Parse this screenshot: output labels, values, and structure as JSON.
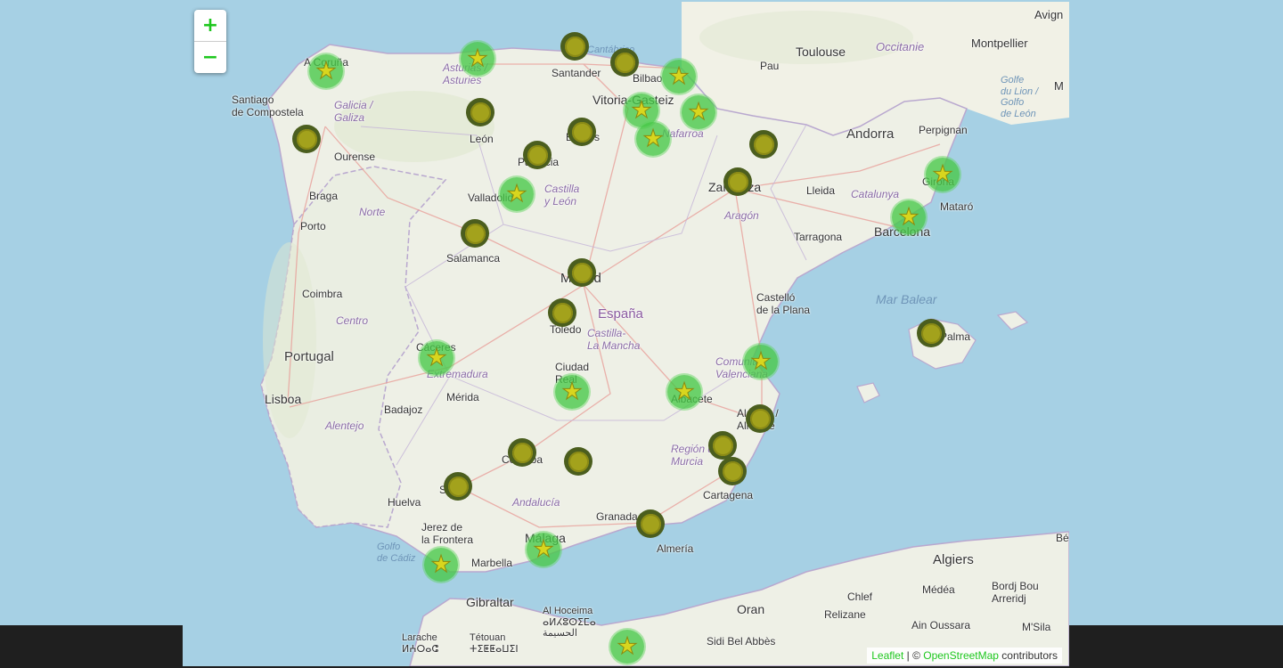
{
  "map": {
    "zoom_in_label": "+",
    "zoom_out_label": "−",
    "attribution": {
      "leaflet": "Leaflet",
      "separator": " | © ",
      "osm": "OpenStreetMap",
      "suffix": " contributors"
    }
  },
  "labels": {
    "toulouse": "Toulouse",
    "occitanie": "Occitanie",
    "montpellier": "Montpellier",
    "avignon": "Avign",
    "pau": "Pau",
    "andorra": "Andorra",
    "perpignan": "Perpignan",
    "golfe_lion": "Golfe\ndu Lion /\nGolfo\nde León",
    "m_edge": "M",
    "a_coruna": "A Coruña",
    "santiago": "Santiago\nde Compostela",
    "galicia": "Galicia /\nGaliza",
    "ourense": "Ourense",
    "asturias": "Asturias /\nAsturies",
    "leon": "León",
    "santander": "Santander",
    "cantabrico": "Cantábrico",
    "bilbao": "Bilbao",
    "vitoria": "Vitoria-Gasteiz",
    "navarra": "Nafarroa",
    "burgos": "Burgos",
    "palencia": "Palencia",
    "valladolid": "Valladolid",
    "castilla_leon": "Castilla\ny León",
    "zaragoza": "Zaragoza",
    "aragon": "Aragón",
    "lleida": "Lleida",
    "catalunya": "Catalunya",
    "girona": "Girona",
    "mataro": "Mataró",
    "barcelona": "Barcelona",
    "tarragona": "Tarragona",
    "braga": "Braga",
    "norte": "Norte",
    "porto": "Porto",
    "salamanca": "Salamanca",
    "madrid": "Madrid",
    "coimbra": "Coimbra",
    "centro": "Centro",
    "espana": "España",
    "toledo": "Toledo",
    "castellon": "Castelló\nde la Plana",
    "mar_balear": "Mar Balear",
    "palma": "Palma",
    "portugal": "Portugal",
    "caceres": "Cáceres",
    "castilla_mancha": "Castilla-\nLa Mancha",
    "ciudad_real": "Ciudad\nReal",
    "comunitat": "Comunitat\nValenciana",
    "extremadura": "Extremadura",
    "merida": "Mérida",
    "albacete": "Albacete",
    "lisboa": "Lisboa",
    "badajoz": "Badajoz",
    "alicante": "Alacant /\nAlicante",
    "alentejo": "Alentejo",
    "cordoba": "Córdoba",
    "jaen": "Jaén",
    "murcia": "Región de\nMurcia",
    "sevilla": "Sevilla",
    "andalucia": "Andalucía",
    "huelva": "Huelva",
    "granada": "Granada",
    "cartagena": "Cartagena",
    "jerez": "Jerez de\nla Frontera",
    "malaga": "Málaga",
    "almeria": "Almería",
    "golfo_cadiz": "Golfo\nde Cádiz",
    "marbella": "Marbella",
    "gibraltar": "Gibraltar",
    "algiers": "Algiers",
    "medea": "Médéa",
    "bordj": "Bordj Bou\nArreridj",
    "chlef": "Chlef",
    "relizane": "Relizane",
    "oran": "Oran",
    "alhoceima": "Al Hoceima\nⴰⵍⵃⵓⵙⵉⵎⴰ\nالحسيمة",
    "larache": "Larache\nⵍⵄⵔⴰⵛ",
    "tetouan": "Tétouan\nⵜⵉⵟⵟⴰⵡⵉⵏ",
    "sidi_bel_abbes": "Sidi Bel Abbès",
    "ain_oussara": "Ain Oussara",
    "msila": "M'Sila",
    "be_edge": "Bé"
  },
  "markers": [
    {
      "place": "A Coruña",
      "icon": "star-icon"
    },
    {
      "place": "Asturias",
      "icon": "star-icon"
    },
    {
      "place": "Santander",
      "icon": "dot-icon"
    },
    {
      "place": "Bilbao",
      "icon": "dot-icon"
    },
    {
      "place": "Donostia",
      "icon": "star-icon"
    },
    {
      "place": "Vitoria-Gasteiz",
      "icon": "star-icon"
    },
    {
      "place": "Navarra",
      "icon": "star-icon"
    },
    {
      "place": "La Rioja",
      "icon": "star-icon"
    },
    {
      "place": "Pontevedra",
      "icon": "dot-icon"
    },
    {
      "place": "León",
      "icon": "dot-icon"
    },
    {
      "place": "Burgos",
      "icon": "dot-icon"
    },
    {
      "place": "Palencia",
      "icon": "dot-icon"
    },
    {
      "place": "Huesca",
      "icon": "dot-icon"
    },
    {
      "place": "Valladolid",
      "icon": "star-icon"
    },
    {
      "place": "Zaragoza",
      "icon": "dot-icon"
    },
    {
      "place": "Girona",
      "icon": "star-icon"
    },
    {
      "place": "Barcelona",
      "icon": "star-icon"
    },
    {
      "place": "Zamora",
      "icon": "dot-icon"
    },
    {
      "place": "Madrid",
      "icon": "dot-icon"
    },
    {
      "place": "Toledo",
      "icon": "dot-icon"
    },
    {
      "place": "Palma",
      "icon": "dot-icon"
    },
    {
      "place": "Cáceres",
      "icon": "star-icon"
    },
    {
      "place": "Castellón",
      "icon": "star-icon"
    },
    {
      "place": "Ciudad Real",
      "icon": "star-icon"
    },
    {
      "place": "Albacete",
      "icon": "star-icon"
    },
    {
      "place": "Alicante",
      "icon": "dot-icon"
    },
    {
      "place": "Córdoba",
      "icon": "dot-icon"
    },
    {
      "place": "Jaén",
      "icon": "dot-icon"
    },
    {
      "place": "Murcia",
      "icon": "dot-icon"
    },
    {
      "place": "Cartagena",
      "icon": "dot-icon"
    },
    {
      "place": "Sevilla",
      "icon": "dot-icon"
    },
    {
      "place": "Almería",
      "icon": "dot-icon"
    },
    {
      "place": "Málaga",
      "icon": "star-icon"
    },
    {
      "place": "Cádiz",
      "icon": "star-icon"
    },
    {
      "place": "Melilla",
      "icon": "star-icon"
    }
  ],
  "colors": {
    "sea": "#a6d0e4",
    "land": "#eef0e6",
    "zoom_accent": "#1ec71e",
    "marker_star_halo": "#46c846",
    "marker_star": "#d8d61e",
    "marker_dot_ring": "#4b5e1e",
    "marker_dot": "#a3a21c"
  }
}
